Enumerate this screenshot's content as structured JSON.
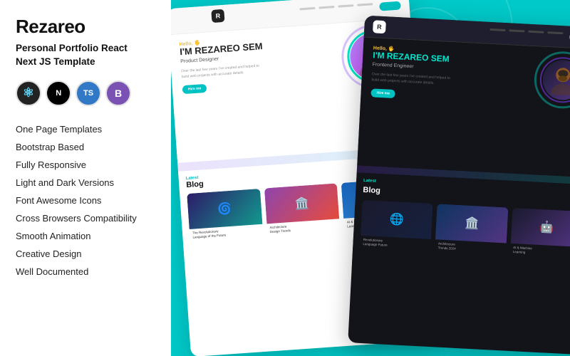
{
  "brand": {
    "title": "Rezareo",
    "subtitle": "Personal Portfolio React\nNext JS Template"
  },
  "badges": [
    {
      "id": "react",
      "label": "⚛",
      "title": "React"
    },
    {
      "id": "next",
      "label": "N",
      "title": "Next.js"
    },
    {
      "id": "ts",
      "label": "TS",
      "title": "TypeScript"
    },
    {
      "id": "bs",
      "label": "B",
      "title": "Bootstrap"
    }
  ],
  "features": [
    "One Page Templates",
    "Bootstrap Based",
    "Fully Responsive",
    "Light and Dark Versions",
    "Font Awesome Icons",
    "Cross Browsers Compatibility",
    "Smooth Animation",
    "Creative Design",
    "Well Documented"
  ],
  "mockup_light": {
    "greeting": "Hello, 🖐",
    "name": "I'M REZAREO SEM",
    "role": "Product Designer",
    "desc": "Over the last few years I've created and helped to build web projects with accurate details.",
    "btn_label": "Hire me",
    "blog_title": "Latest Blog"
  },
  "mockup_dark": {
    "greeting": "Hello, 🖐",
    "name": "I'M REZAREO SEM",
    "role": "Frontend Engineer",
    "desc": "Over the last few years I've created and helped to build web projects with accurate details.",
    "btn_label": "Hire me",
    "blog_title": "Latest Blog"
  }
}
